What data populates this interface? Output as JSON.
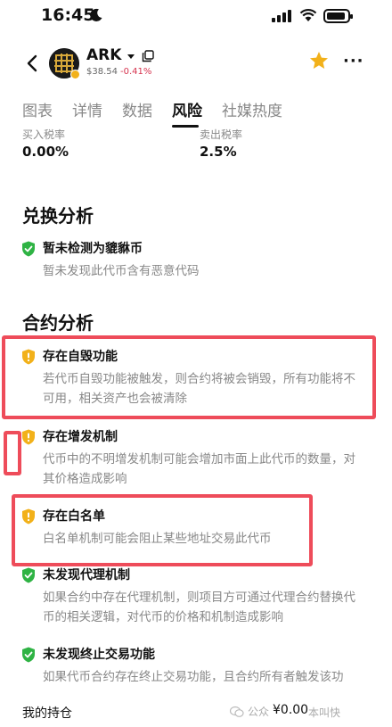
{
  "status_bar": {
    "time": "16:45"
  },
  "header": {
    "symbol": "ARK",
    "price": "$38.54",
    "change": "-0.41%",
    "change_color": "#d6334e",
    "star_color": "#f2b11a",
    "icons": [
      "back-icon",
      "caret-down-icon",
      "copy-icon",
      "star-icon",
      "more-icon"
    ]
  },
  "tabs": [
    {
      "label": "图表",
      "active": false
    },
    {
      "label": "详情",
      "active": false
    },
    {
      "label": "数据",
      "active": false
    },
    {
      "label": "风险",
      "active": true
    },
    {
      "label": "社媒热度",
      "active": false
    }
  ],
  "taxes": {
    "buy_label": "买入税率",
    "buy_value": "0.00%",
    "sell_label": "卖出税率",
    "sell_value": "2.5%"
  },
  "exchange_analysis": {
    "title": "兑换分析",
    "items": [
      {
        "status": "safe",
        "title": "暂未检测为貔貅币",
        "desc": "暂未发现此代币含有恶意代码"
      }
    ]
  },
  "contract_analysis": {
    "title": "合约分析",
    "items": [
      {
        "status": "warning",
        "title": "存在自毁功能",
        "desc": "若代币自毁功能被触发，则合约将被会销毁，所有功能将不可用，相关资产也会被清除"
      },
      {
        "status": "warning",
        "title": "存在增发机制",
        "desc": "代币中的不明增发机制可能会增加市面上此代币的数量，对其价格造成影响"
      },
      {
        "status": "warning",
        "title": "存在白名单",
        "desc": "白名单机制可能会阻止某些地址交易此代币"
      },
      {
        "status": "safe",
        "title": "未发现代理机制",
        "desc": "如果合约中存在代理机制，则项目方可通过代理合约替换代币的相关逻辑，对代币的价格和机制造成影响"
      },
      {
        "status": "safe",
        "title": "未发现终止交易功能",
        "desc": "如果代币合约存在终止交易功能，且合约所有者触发该功"
      }
    ]
  },
  "colors": {
    "safe": "#2fb344",
    "warning": "#f2b11a",
    "highlight": "#ee4c5a"
  },
  "bottom_bar": {
    "holdings_label": "我的持仓",
    "holdings_value": "¥0.00",
    "watermark_left": "公众",
    "watermark_right": "本叫快"
  }
}
